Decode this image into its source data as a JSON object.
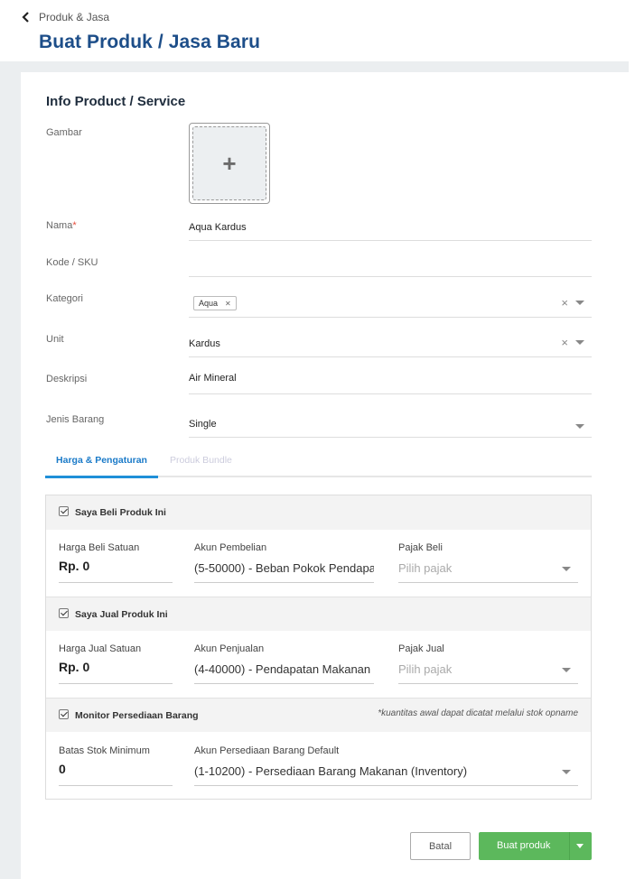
{
  "header": {
    "back_label": "Produk & Jasa",
    "title": "Buat Produk / Jasa Baru"
  },
  "section_title": "Info Product / Service",
  "form": {
    "image_label": "Gambar",
    "image_plus": "+",
    "name_label": "Nama",
    "name_required": "*",
    "name_value": "Aqua Kardus",
    "sku_label": "Kode / SKU",
    "sku_value": "",
    "category_label": "Kategori",
    "category_tags": [
      "Aqua"
    ],
    "unit_label": "Unit",
    "unit_value": "Kardus",
    "description_label": "Deskripsi",
    "description_value": "Air Mineral",
    "item_type_label": "Jenis Barang",
    "item_type_value": "Single"
  },
  "tabs": [
    {
      "label": "Harga & Pengaturan",
      "active": true
    },
    {
      "label": "Produk Bundle",
      "active": false
    }
  ],
  "buy": {
    "checkbox_label": "Saya Beli Produk Ini",
    "checked": true,
    "price_label": "Harga Beli Satuan",
    "price_value": "Rp. 0",
    "account_label": "Akun Pembelian",
    "account_value": "(5-50000) - Beban Pokok Pendapa",
    "tax_label": "Pajak Beli",
    "tax_placeholder": "Pilih pajak"
  },
  "sell": {
    "checkbox_label": "Saya Jual Produk Ini",
    "checked": true,
    "price_label": "Harga Jual Satuan",
    "price_value": "Rp. 0",
    "account_label": "Akun Penjualan",
    "account_value": "(4-40000) - Pendapatan Makanan",
    "tax_label": "Pajak Jual",
    "tax_placeholder": "Pilih pajak"
  },
  "inventory": {
    "checkbox_label": "Monitor Persediaan Barang",
    "checked": true,
    "note": "*kuantitas awal dapat dicatat melalui stok opname",
    "min_stock_label": "Batas Stok Minimum",
    "min_stock_value": "0",
    "account_label": "Akun Persediaan Barang Default",
    "account_value": "(1-10200) - Persediaan Barang Makanan (Inventory)"
  },
  "actions": {
    "cancel_label": "Batal",
    "submit_label": "Buat produk"
  },
  "colors": {
    "title_blue": "#1d4e89",
    "tab_blue": "#1f8fd8",
    "submit_green": "#5cb85c",
    "required_red": "#e74c3c"
  }
}
